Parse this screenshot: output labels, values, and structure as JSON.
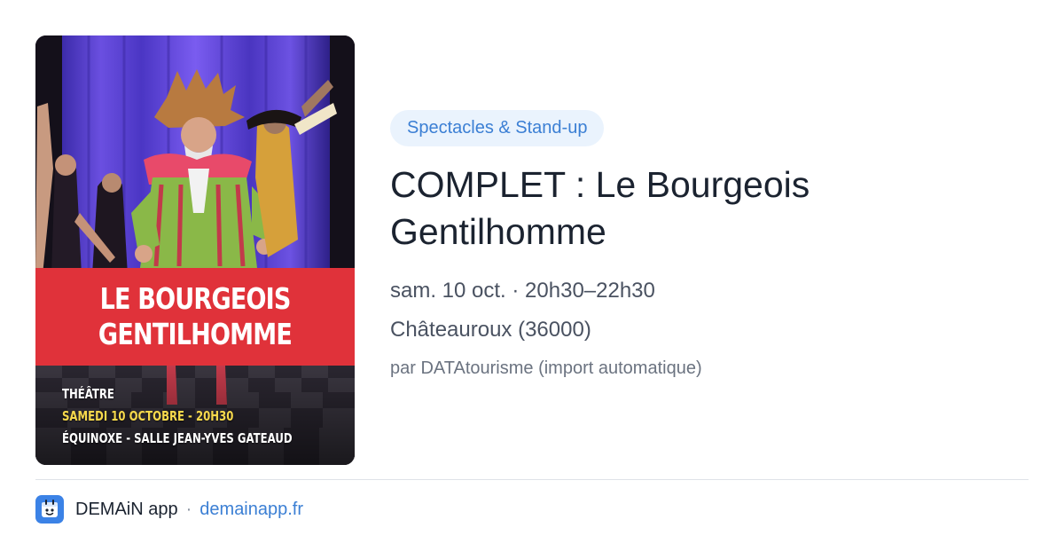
{
  "poster": {
    "title_line1": "LE BOURGEOIS",
    "title_line2": "GENTILHOMME",
    "genre": "THÉÂTRE",
    "date": "SAMEDI 10 OCTOBRE - 20H30",
    "venue": "ÉQUINOXE - SALLE JEAN-YVES GATEAUD",
    "banner_color": "#e0323a"
  },
  "event": {
    "category": "Spectacles & Stand-up",
    "title": "COMPLET : Le Bourgeois Gentilhomme",
    "datetime": "sam. 10 oct. · 20h30–22h30",
    "location": "Châteauroux (36000)",
    "source": "par DATAtourisme (import automatique)"
  },
  "footer": {
    "app_icon": "demain-app-icon",
    "app_name": "DEMAiN app",
    "separator": "·",
    "link_text": "demainapp.fr"
  },
  "colors": {
    "accent": "#3b7fd4",
    "pill_background": "#eaf3fd",
    "title_text": "#1b2330"
  }
}
